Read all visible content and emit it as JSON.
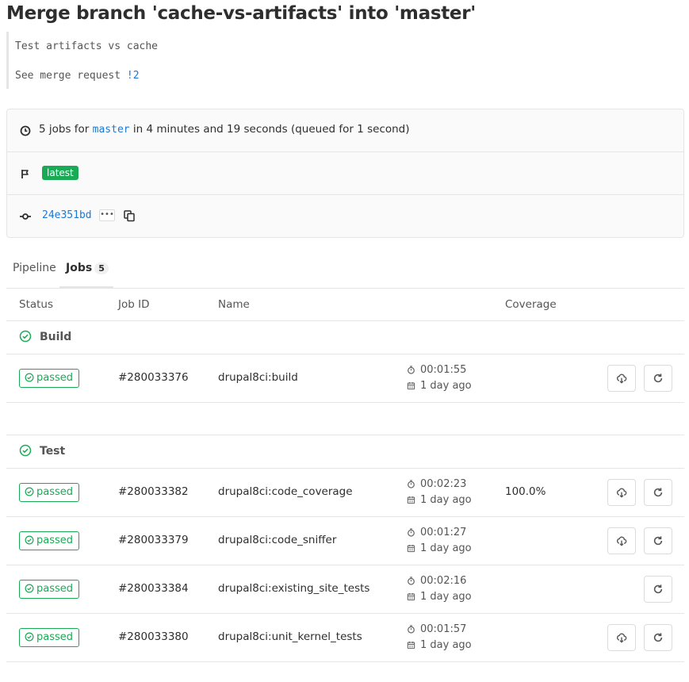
{
  "title": "Merge branch 'cache-vs-artifacts' into 'master'",
  "description": {
    "line1": "Test artifacts vs cache",
    "line2_prefix": "See merge request ",
    "line2_link": "!2"
  },
  "info": {
    "jobs_prefix": "5 jobs for ",
    "branch": "master",
    "jobs_suffix": " in 4 minutes and 19 seconds (queued for 1 second)",
    "badge": "latest",
    "sha": "24e351bd",
    "ellipsis": "•••"
  },
  "tabs": {
    "pipeline": "Pipeline",
    "jobs": "Jobs",
    "jobs_count": "5"
  },
  "columns": {
    "status": "Status",
    "job_id": "Job ID",
    "name": "Name",
    "coverage": "Coverage"
  },
  "stages": [
    {
      "name": "Build",
      "jobs": [
        {
          "status": "passed",
          "id": "#280033376",
          "name": "drupal8ci:build",
          "duration": "00:01:55",
          "ago": "1 day ago",
          "coverage": "",
          "download": true
        }
      ]
    },
    {
      "name": "Test",
      "jobs": [
        {
          "status": "passed",
          "id": "#280033382",
          "name": "drupal8ci:code_coverage",
          "duration": "00:02:23",
          "ago": "1 day ago",
          "coverage": "100.0%",
          "download": true
        },
        {
          "status": "passed",
          "id": "#280033379",
          "name": "drupal8ci:code_sniffer",
          "duration": "00:01:27",
          "ago": "1 day ago",
          "coverage": "",
          "download": true
        },
        {
          "status": "passed",
          "id": "#280033384",
          "name": "drupal8ci:existing_site_tests",
          "duration": "00:02:16",
          "ago": "1 day ago",
          "coverage": "",
          "download": false
        },
        {
          "status": "passed",
          "id": "#280033380",
          "name": "drupal8ci:unit_kernel_tests",
          "duration": "00:01:57",
          "ago": "1 day ago",
          "coverage": "",
          "download": true
        }
      ]
    }
  ],
  "colors": {
    "success": "#1aaa55",
    "link": "#1f78d1"
  }
}
